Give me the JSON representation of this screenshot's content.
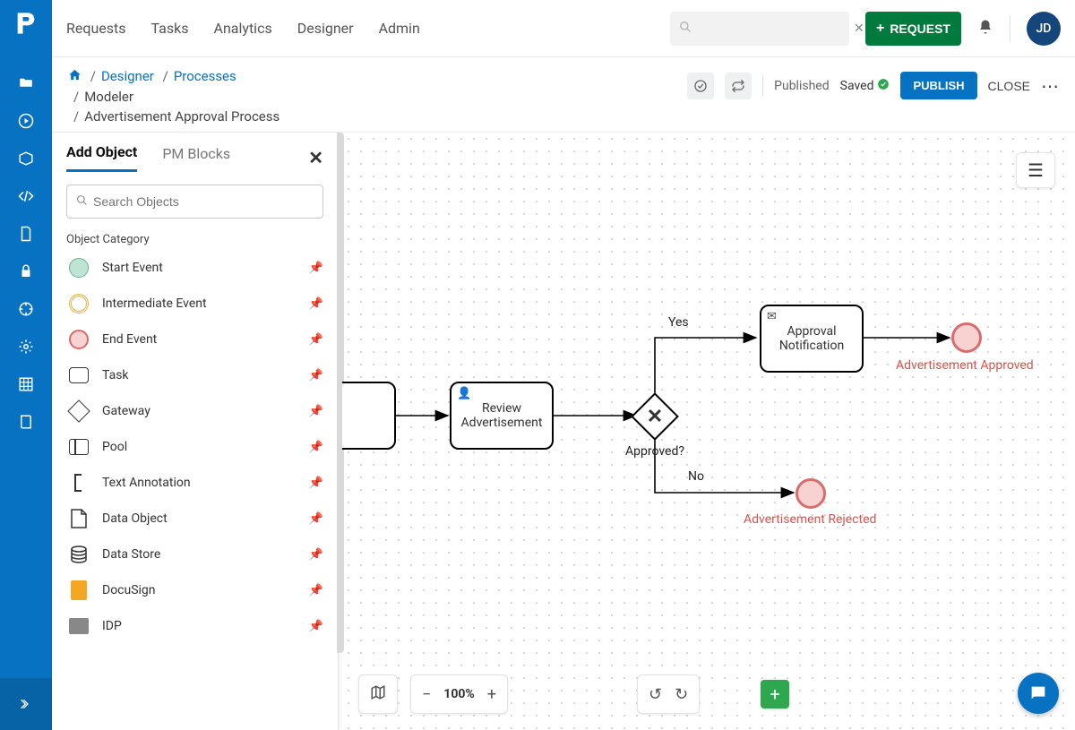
{
  "topnav": {
    "items": [
      "Requests",
      "Tasks",
      "Analytics",
      "Designer",
      "Admin"
    ]
  },
  "requestBtn": "REQUEST",
  "avatar": "JD",
  "breadcrumbs": {
    "designer": "Designer",
    "processes": "Processes",
    "modeler": "Modeler",
    "current": "Advertisement Approval Process"
  },
  "status": {
    "published": "Published",
    "saved": "Saved"
  },
  "actions": {
    "publish": "PUBLISH",
    "close": "CLOSE"
  },
  "palette": {
    "tabs": {
      "add": "Add Object",
      "pm": "PM Blocks"
    },
    "searchPlaceholder": "Search Objects",
    "categoryLabel": "Object Category",
    "items": [
      {
        "label": "Start Event",
        "shape": "start"
      },
      {
        "label": "Intermediate Event",
        "shape": "inter"
      },
      {
        "label": "End Event",
        "shape": "end"
      },
      {
        "label": "Task",
        "shape": "task"
      },
      {
        "label": "Gateway",
        "shape": "gateway"
      },
      {
        "label": "Pool",
        "shape": "pool"
      },
      {
        "label": "Text Annotation",
        "shape": "textann"
      },
      {
        "label": "Data Object",
        "shape": "dataobj"
      },
      {
        "label": "Data Store",
        "shape": "datastore"
      },
      {
        "label": "DocuSign",
        "shape": "docusign"
      },
      {
        "label": "IDP",
        "shape": "idp"
      }
    ]
  },
  "canvas": {
    "reviewTask": "Review\nAdvertisement",
    "approvalTask": "Approval\nNotification",
    "gatewayLabel": "Approved?",
    "yes": "Yes",
    "no": "No",
    "end1": "Advertisement Approved",
    "end2": "Advertisement Rejected"
  },
  "zoom": "100%"
}
